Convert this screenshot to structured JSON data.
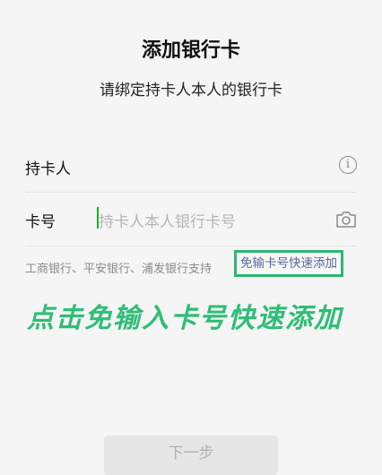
{
  "header": {
    "title": "添加银行卡",
    "subtitle": "请绑定持卡人本人的银行卡"
  },
  "form": {
    "holder": {
      "label": "持卡人",
      "icon": "info-icon"
    },
    "card": {
      "label": "卡号",
      "placeholder": "持卡人本人银行卡号",
      "icon": "camera-icon"
    }
  },
  "banks_text": "工商银行、平安银行、浦发银行支持",
  "quick_add_label": "免输卡号快速添加",
  "annotation_text": "点击免输入卡号快速添加",
  "next_button_label": "下一步",
  "colors": {
    "accent": "#2bb673",
    "link": "#576b95",
    "cursor": "#1aad19"
  }
}
